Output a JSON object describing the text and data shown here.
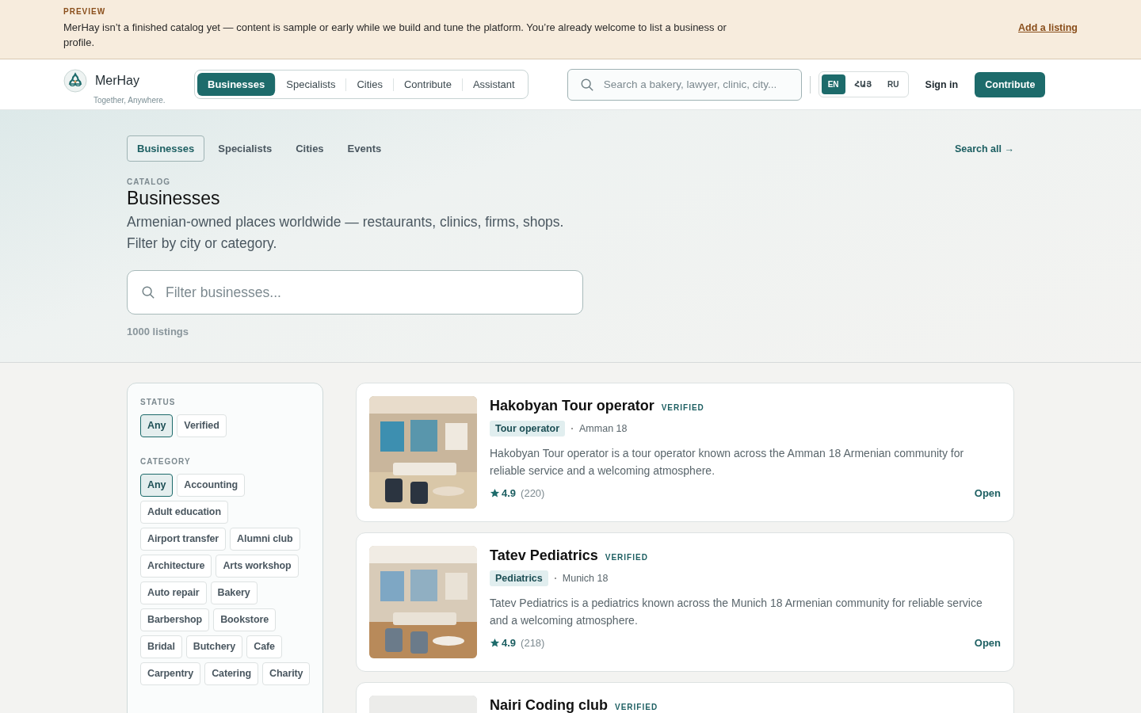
{
  "banner": {
    "label": "PREVIEW",
    "message": "MerHay isn’t a finished catalog yet — content is sample or early while we build and tune the platform. You’re already welcome to list a business or profile.",
    "link": "Add a listing"
  },
  "header": {
    "brand": "MerHay",
    "tagline": "Together, Anywhere.",
    "nav": [
      {
        "label": "Businesses",
        "selected": true
      },
      {
        "label": "Specialists",
        "selected": false
      },
      {
        "label": "Cities",
        "selected": false
      },
      {
        "label": "Contribute",
        "selected": false
      },
      {
        "label": "Assistant",
        "selected": false
      }
    ],
    "search": {
      "placeholder": "Search a bakery, lawyer, clinic, city..."
    },
    "languages": [
      {
        "label": "EN",
        "selected": true
      },
      {
        "label": "ՀԱՅ",
        "selected": false
      },
      {
        "label": "RU",
        "selected": false
      }
    ],
    "sign_in": "Sign in",
    "cta": "Contribute"
  },
  "hero": {
    "tabs": [
      {
        "label": "Businesses",
        "selected": true
      },
      {
        "label": "Specialists",
        "selected": false
      },
      {
        "label": "Cities",
        "selected": false
      },
      {
        "label": "Events",
        "selected": false
      }
    ],
    "search_all": "Search all →",
    "eyebrow": "CATALOG",
    "title": "Businesses",
    "description": "Armenian-owned places worldwide — restaurants, clinics, firms, shops. Filter by city or category.",
    "filter": {
      "placeholder": "Filter businesses..."
    },
    "count": "1000 listings"
  },
  "filters": [
    {
      "heading": "STATUS",
      "options": [
        {
          "label": "Any",
          "selected": true
        },
        {
          "label": "Verified",
          "selected": false
        }
      ]
    },
    {
      "heading": "CATEGORY",
      "options": [
        {
          "label": "Any",
          "selected": true
        },
        {
          "label": "Accounting",
          "selected": false
        },
        {
          "label": "Adult education",
          "selected": false
        },
        {
          "label": "Airport transfer",
          "selected": false
        },
        {
          "label": "Alumni club",
          "selected": false
        },
        {
          "label": "Architecture",
          "selected": false
        },
        {
          "label": "Arts workshop",
          "selected": false
        },
        {
          "label": "Auto repair",
          "selected": false
        },
        {
          "label": "Bakery",
          "selected": false
        },
        {
          "label": "Barbershop",
          "selected": false
        },
        {
          "label": "Bookstore",
          "selected": false
        },
        {
          "label": "Bridal",
          "selected": false
        },
        {
          "label": "Butchery",
          "selected": false
        },
        {
          "label": "Cafe",
          "selected": false
        },
        {
          "label": "Carpentry",
          "selected": false
        },
        {
          "label": "Catering",
          "selected": false
        },
        {
          "label": "Charity",
          "selected": false
        }
      ]
    }
  ],
  "listings": [
    {
      "name": "Hakobyan Tour operator",
      "badge": "VERIFIED",
      "category": "Tour operator",
      "city": "Amman 18",
      "description": "Hakobyan Tour operator is a tour operator known across the Amman 18 Armenian community for reliable service and a welcoming atmosphere.",
      "rating": "4.9",
      "reviews": "(220)",
      "action": "Open"
    },
    {
      "name": "Tatev Pediatrics",
      "badge": "VERIFIED",
      "category": "Pediatrics",
      "city": "Munich 18",
      "description": "Tatev Pediatrics is a pediatrics known across the Munich 18 Armenian community for reliable service and a welcoming atmosphere.",
      "rating": "4.9",
      "reviews": "(218)",
      "action": "Open"
    },
    {
      "name": "Nairi Coding club",
      "badge": "VERIFIED"
    }
  ]
}
